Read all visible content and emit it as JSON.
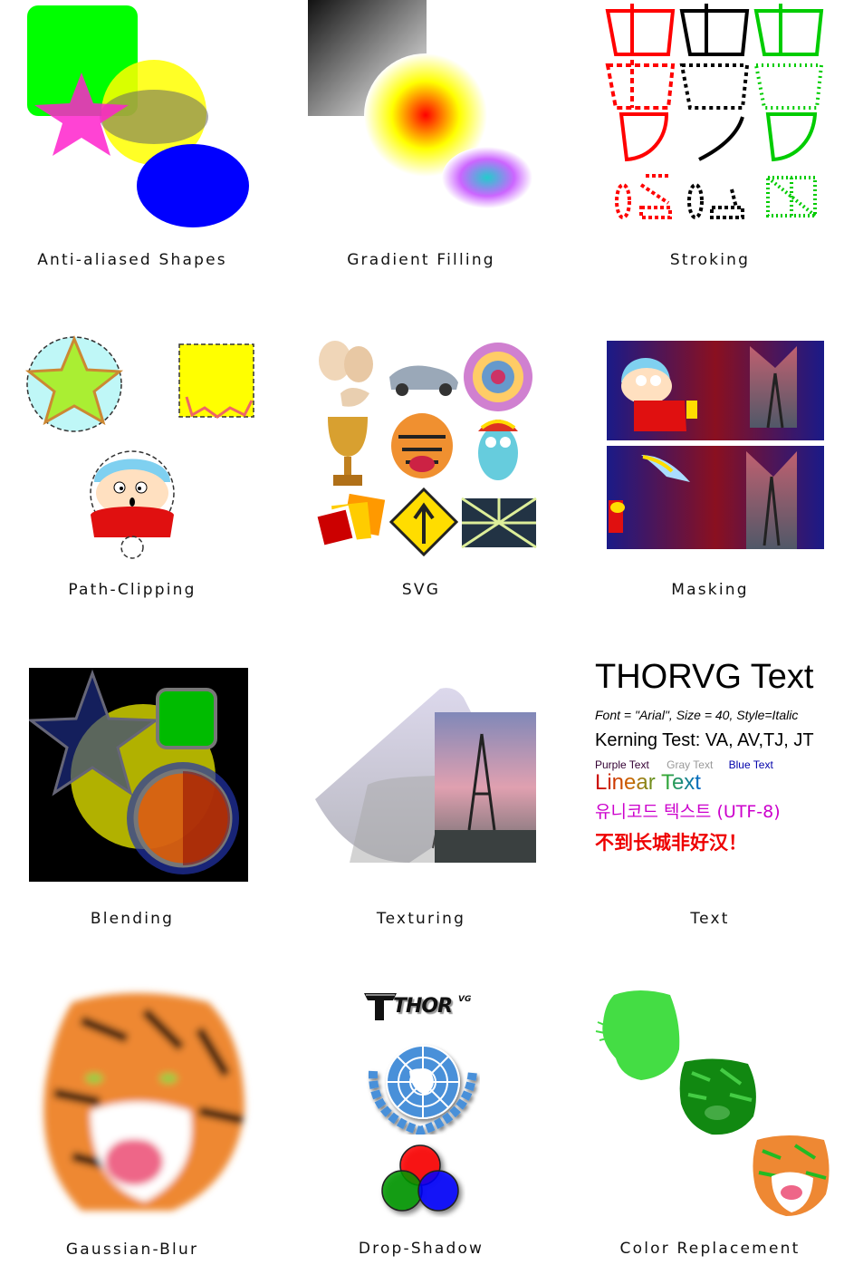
{
  "features": [
    {
      "id": "anti-aliased-shapes",
      "caption": "Anti-aliased Shapes"
    },
    {
      "id": "gradient-filling",
      "caption": "Gradient Filling"
    },
    {
      "id": "stroking",
      "caption": "Stroking"
    },
    {
      "id": "path-clipping",
      "caption": "Path-Clipping"
    },
    {
      "id": "svg",
      "caption": "SVG"
    },
    {
      "id": "masking",
      "caption": "Masking"
    },
    {
      "id": "blending",
      "caption": "Blending"
    },
    {
      "id": "texturing",
      "caption": "Texturing"
    },
    {
      "id": "text",
      "caption": "Text"
    },
    {
      "id": "gaussian-blur",
      "caption": "Gaussian-Blur"
    },
    {
      "id": "drop-shadow",
      "caption": "Drop-Shadow"
    },
    {
      "id": "color-replacement",
      "caption": "Color Replacement"
    }
  ],
  "text_demo": {
    "headline": "THORVG Text",
    "font_line": "Font = \"Arial\", Size = 40, Style=Italic",
    "kerning_line": "Kerning Test: VA, AV,TJ, JT",
    "purple": "Purple Text",
    "gray": "Gray Text",
    "blue": "Blue Text",
    "linear": "Linear Text",
    "korean": "유니코드 텍스트 (UTF-8)",
    "chinese": "不到长城非好汉！"
  },
  "drop_shadow_logo": "THOR",
  "drop_shadow_logo_sup": "VG",
  "colors": {
    "green": "#00ff00",
    "yellow": "#ffff00",
    "blue": "#0000ff",
    "magenta": "#ff33cc",
    "red": "#ff0000",
    "black": "#000000"
  }
}
